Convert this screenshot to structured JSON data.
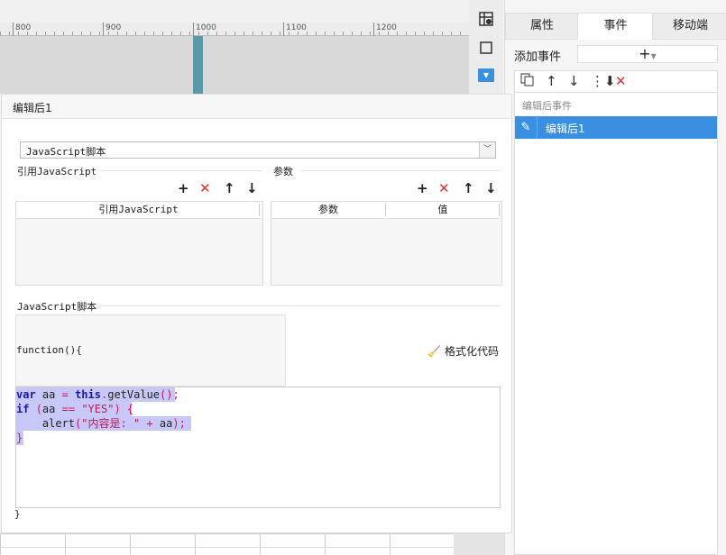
{
  "ruler": {
    "marks": [
      "800",
      "900",
      "1000",
      "1100",
      "1200"
    ]
  },
  "right_panel": {
    "tabs": [
      {
        "label": "属性",
        "active": false
      },
      {
        "label": "事件",
        "active": true
      },
      {
        "label": "移动端",
        "active": false
      }
    ],
    "add_event_label": "添加事件",
    "add_event_button": "+",
    "event_group": "编辑后事件",
    "event_item": "编辑后1"
  },
  "dialog": {
    "title": "编辑后1",
    "script_type": "JavaScript脚本",
    "ref_js_section": "引用JavaScript",
    "ref_js_column": "引用JavaScript",
    "params_section": "参数",
    "params_columns": [
      "参数",
      "值"
    ],
    "script_section": "JavaScript脚本",
    "func_open": "function(){",
    "format_button": "格式化代码",
    "code_lines": [
      "var aa = this.getValue();",
      "if (aa == \"YES\") {",
      "    alert(\"内容是: \" + aa);",
      "}"
    ],
    "func_close": "}"
  },
  "colors": {
    "accent": "#3a8fe0",
    "delete": "#e03030",
    "selection": "#c8c8f8"
  }
}
